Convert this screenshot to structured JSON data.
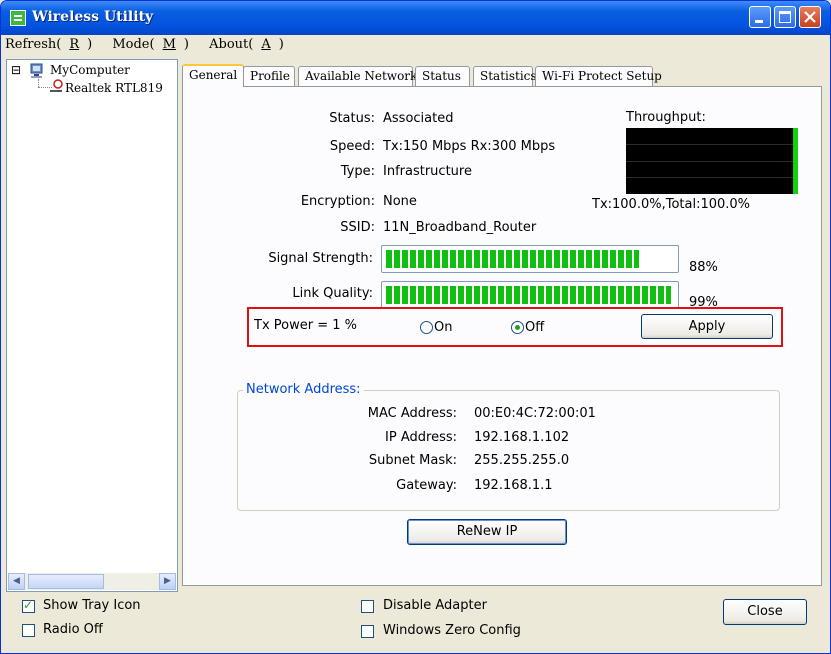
{
  "window": {
    "title": "Wireless Utility"
  },
  "menu": [
    {
      "pre": "Refresh(",
      "key": "R",
      "post": ")"
    },
    {
      "pre": "Mode(",
      "key": "M",
      "post": ")"
    },
    {
      "pre": "About(",
      "key": "A",
      "post": ")"
    }
  ],
  "tree": {
    "root": "MyComputer",
    "expander": "⊟",
    "child": "Realtek RTL819"
  },
  "tabs": [
    "General",
    "Profile",
    "Available Network",
    "Status",
    "Statistics",
    "Wi-Fi Protect Setup"
  ],
  "active_tab": "General",
  "general": {
    "status_label": "Status:",
    "status_value": "Associated",
    "speed_label": "Speed:",
    "speed_value": "Tx:150 Mbps Rx:300 Mbps",
    "type_label": "Type:",
    "type_value": "Infrastructure",
    "encryption_label": "Encryption:",
    "encryption_value": "None",
    "ssid_label": "SSID:",
    "ssid_value": "11N_Broadband_Router",
    "throughput_label": "Throughput:",
    "throughput_value": "Tx:100.0%,Total:100.0%",
    "signal_label": "Signal Strength:",
    "signal_percent": 88,
    "signal_text": "88%",
    "link_label": "Link Quality:",
    "link_percent": 99,
    "link_text": "99%",
    "txpower_label": "Tx Power =  1 %",
    "radio_on": "On",
    "radio_off": "Off",
    "selected_radio": "Off",
    "apply": "Apply"
  },
  "network": {
    "title": "Network Address:",
    "mac_label": "MAC Address:",
    "mac_value": "00:E0:4C:72:00:01",
    "ip_label": "IP Address:",
    "ip_value": "192.168.1.102",
    "mask_label": "Subnet Mask:",
    "mask_value": "255.255.255.0",
    "gw_label": "Gateway:",
    "gw_value": "192.168.1.1",
    "renew": "ReNew IP"
  },
  "bottom": {
    "show_tray": "Show Tray Icon",
    "show_tray_checked": true,
    "radio_off": "Radio Off",
    "radio_off_checked": false,
    "disable_adapter": "Disable Adapter",
    "disable_adapter_checked": false,
    "zero_config": "Windows Zero Config",
    "zero_config_checked": false,
    "close": "Close"
  },
  "colors": {
    "signal_green": "#10C010",
    "highlight_red": "#E01010",
    "group_title": "#0046D5"
  }
}
